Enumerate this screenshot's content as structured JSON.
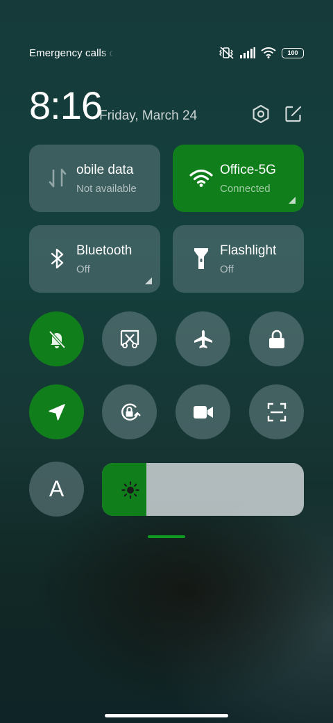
{
  "status_bar": {
    "left_text": "Emergency calls o",
    "battery": "100",
    "icons": [
      "muted-vibrate-icon",
      "signal-icon",
      "wifi-icon",
      "battery-icon"
    ]
  },
  "header": {
    "time": "8:16",
    "date": "Friday, March 24",
    "icons": [
      "settings-icon",
      "edit-icon"
    ]
  },
  "tiles": [
    {
      "title": "obile data",
      "subtitle": "Not available",
      "icon": "mobile-data-icon",
      "active": false
    },
    {
      "title": "Office-5G",
      "subtitle": "Connected",
      "icon": "wifi-icon",
      "active": true
    },
    {
      "title": "Bluetooth",
      "subtitle": "Off",
      "icon": "bluetooth-icon",
      "active": false
    },
    {
      "title": "Flashlight",
      "subtitle": "Off",
      "icon": "flashlight-icon",
      "active": false
    }
  ],
  "round_buttons": [
    {
      "icon": "silent-bell-icon",
      "active": true
    },
    {
      "icon": "screenshot-icon",
      "active": false
    },
    {
      "icon": "airplane-icon",
      "active": false
    },
    {
      "icon": "lock-icon",
      "active": false
    },
    {
      "icon": "location-icon",
      "active": true
    },
    {
      "icon": "rotation-lock-icon",
      "active": false
    },
    {
      "icon": "screen-record-icon",
      "active": false
    },
    {
      "icon": "scanner-icon",
      "active": false
    }
  ],
  "auto_brightness": {
    "label": "A",
    "icon": "auto-brightness-icon"
  },
  "brightness": {
    "level": 0.22,
    "icon": "sun-icon"
  },
  "colors": {
    "accent": "#117e1c",
    "tile_off": "#5d787c",
    "slider_track": "#c2cacc"
  }
}
